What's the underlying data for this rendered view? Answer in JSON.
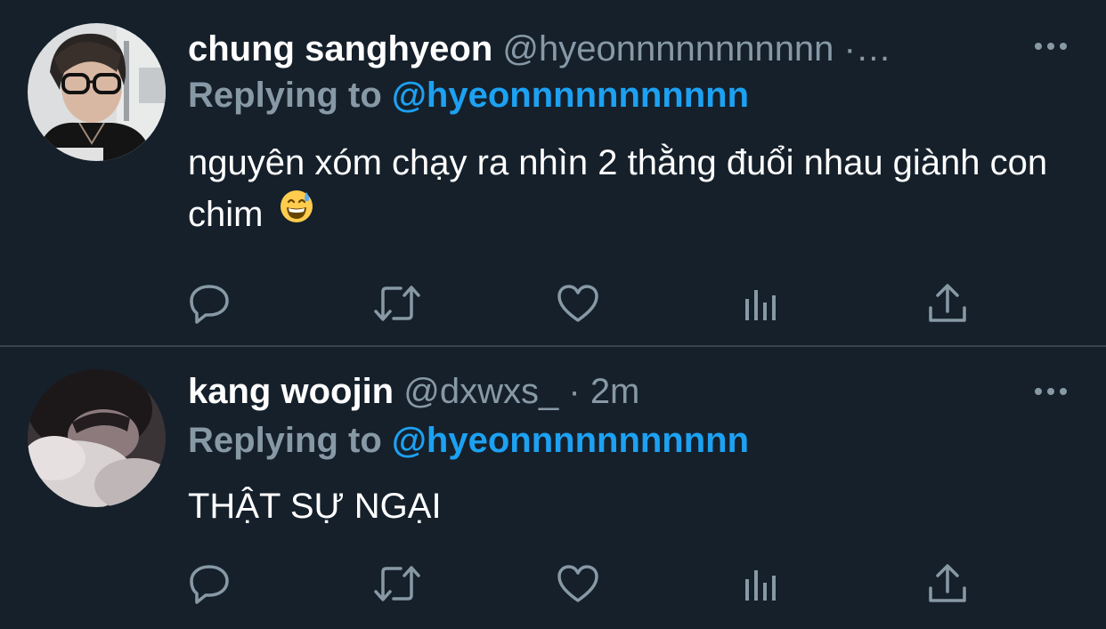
{
  "tweets": [
    {
      "display_name": "chung sanghyeon",
      "handle": "@hyeonnnnnnnnnnn",
      "separator": "·…",
      "replying_label": "Replying to",
      "replying_handle": "@hyeonnnnnnnnnnn",
      "text": "nguyên xóm chạy ra nhìn 2 thằng đuổi nhau giành con chim",
      "emoji": "grinning-face-with-sweat",
      "avatar": "avatar-photo-glasses"
    },
    {
      "display_name": "kang woojin",
      "handle": "@dxwxs_",
      "separator": "·",
      "time": "2m",
      "replying_label": "Replying to",
      "replying_handle": "@hyeonnnnnnnnnnn",
      "text": "THẬT SỰ NGẠI",
      "avatar": "avatar-photo-sleeping"
    }
  ],
  "actions": [
    "reply-icon",
    "retweet-icon",
    "like-icon",
    "analytics-icon",
    "share-icon"
  ],
  "colors": {
    "background": "#15202b",
    "primary_text": "#ffffff",
    "secondary_text": "#8899a6",
    "accent": "#1da1f2",
    "divider": "#38444d"
  }
}
